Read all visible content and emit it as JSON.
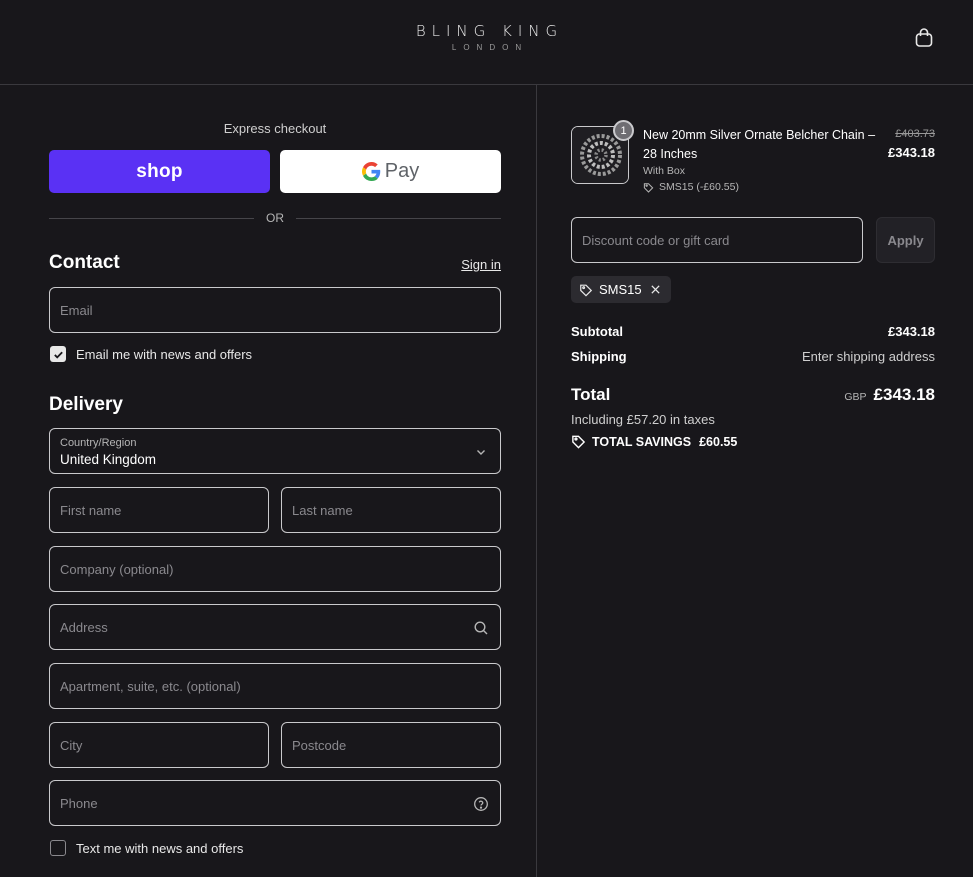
{
  "brand": {
    "name": "BLING KING",
    "sub": "LONDON"
  },
  "express": {
    "label": "Express checkout",
    "shop_label": "shop",
    "gpay_label": "Pay",
    "or_label": "OR"
  },
  "contact": {
    "title": "Contact",
    "sign_in": "Sign in",
    "email_placeholder": "Email",
    "news_label": "Email me with news and offers",
    "news_checked": true
  },
  "delivery": {
    "title": "Delivery",
    "country_label": "Country/Region",
    "country_value": "United Kingdom",
    "first_name": "First name",
    "last_name": "Last name",
    "company": "Company (optional)",
    "address": "Address",
    "apartment": "Apartment, suite, etc. (optional)",
    "city": "City",
    "postcode": "Postcode",
    "phone": "Phone",
    "sms_label": "Text me with news and offers",
    "sms_checked": false
  },
  "order": {
    "item": {
      "quantity": "1",
      "name": "New 20mm Silver Ornate Belcher Chain – 28 Inches",
      "variant": "With Box",
      "discount": "SMS15 (-£60.55)",
      "price_original": "£403.73",
      "price": "£343.18"
    },
    "discount_placeholder": "Discount code or gift card",
    "apply_label": "Apply",
    "applied_code": "SMS15",
    "subtotal_label": "Subtotal",
    "subtotal_value": "£343.18",
    "shipping_label": "Shipping",
    "shipping_value": "Enter shipping address",
    "total_label": "Total",
    "currency": "GBP",
    "total_value": "£343.18",
    "taxes": "Including £57.20 in taxes",
    "savings_label": "TOTAL SAVINGS",
    "savings_value": "£60.55"
  },
  "colors": {
    "background": "#18171b",
    "shop_pay": "#5a31f4",
    "border": "#c9c9cc"
  }
}
